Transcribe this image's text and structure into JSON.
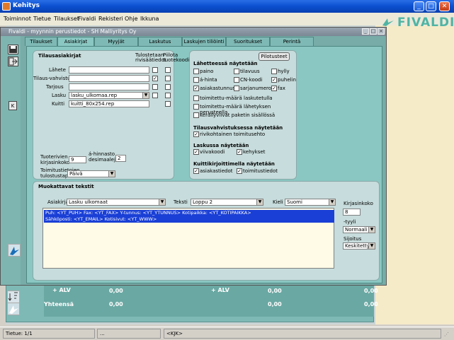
{
  "window": {
    "title": "Kehitys"
  },
  "menu": [
    "Toiminnot",
    "Tietue",
    "Tilaukset",
    "Fivaldi",
    "Rekisteri",
    "Ohje",
    "Ikkuna"
  ],
  "logo": {
    "text": "FIVALDI",
    "color": "#4fb4a4"
  },
  "child": {
    "title": "Fivaldi - myynnin perustiedot - SH Malliyritys Oy"
  },
  "tabs": [
    "Tilaukset",
    "Asiakirjat",
    "Myyjät",
    "Laskutus",
    "Laskujen tiliöinti",
    "Suoritukset",
    "Perintä"
  ],
  "active_tab": "Asiakirjat",
  "tilausasiakirjat": {
    "header": "Tilausasiakirjat",
    "col1": "Tulostetaan rivisäätiedot",
    "col2": "Piilota tuotekoodi",
    "rows": [
      {
        "label": "Lähete",
        "value": "",
        "c1": false,
        "c2": false
      },
      {
        "label": "Tilaus-vahvistus",
        "value": "",
        "c1": true,
        "c2": false
      },
      {
        "label": "Tarjous",
        "value": "",
        "c1": false,
        "c2": false
      },
      {
        "label": "Lasku",
        "value": "lasku_ulkomaa.rep",
        "c1": false,
        "c2": false
      },
      {
        "label": "Kuitti",
        "value": "kuitti_80x254.rep",
        "c1": false,
        "c2": false
      }
    ],
    "tuoterivien_label": "Tuoterivien kirjasinkoko",
    "tuoterivien_value": "9",
    "ahinnasto_label": "á-hinnasto desimaaleja",
    "ahinnasto_value": "2",
    "toimitus_label": "Toimitustietojen tulostustapa",
    "toimitus_value": "Päivä"
  },
  "pilotusteet_button": "Pilotusteet",
  "lahetteessa": {
    "header": "Lähetteessä näytetään",
    "items": [
      {
        "label": "paino",
        "checked": false
      },
      {
        "label": "tilavuus",
        "checked": false
      },
      {
        "label": "hylly",
        "checked": false
      },
      {
        "label": "á-hinta",
        "checked": false
      },
      {
        "label": "CN-koodi",
        "checked": false
      },
      {
        "label": "puhelin",
        "checked": true
      },
      {
        "label": "asiakastunnus",
        "checked": true
      },
      {
        "label": "sarjanumerot",
        "checked": false
      },
      {
        "label": "fax",
        "checked": true
      }
    ],
    "wide_items": [
      {
        "label": "toimitettu-määrä laskutetulla",
        "checked": false
      },
      {
        "label": "toimitettu-määrä lähetyksen perusteella",
        "checked": false
      },
      {
        "label": "keräilyviivat paketin sisällössä",
        "checked": false
      }
    ]
  },
  "tilausvahvistus": {
    "header": "Tilausvahvistuksessa näytetään",
    "items": [
      {
        "label": "rivikohtainen toimitusehto",
        "checked": true
      }
    ]
  },
  "laskussa": {
    "header": "Laskussa näytetään",
    "items": [
      {
        "label": "viivakoodi",
        "checked": true
      },
      {
        "label": "kehykset",
        "checked": true
      }
    ]
  },
  "kuitti": {
    "header": "Kuittikirjoittimella näytetään",
    "items": [
      {
        "label": "asiakastiedot",
        "checked": true
      },
      {
        "label": "toimitustiedot",
        "checked": true
      }
    ]
  },
  "muokattavat": {
    "header": "Muokattavat tekstit",
    "asiakirja_label": "Asiakirja",
    "asiakirja_value": "Lasku ulkomaat",
    "teksti_label": "Teksti",
    "teksti_value": "Loppu 2",
    "kieli_label": "Kieli",
    "kieli_value": "Suomi",
    "lines": [
      "Puh: <YT_PUH> Fax: <YT_FAX> Y-tunnus: <YT_YTUNNUS> Kotipaikka: <YT_KOTIPAIKKA>",
      "Sähköposti: <YT_EMAIL> Kotisivut: <YT_WWW>"
    ],
    "kirjasinkoko_label": "Kirjasinkoko",
    "kirjasinkoko_value": "8",
    "tyyli_label": "-tyyli",
    "tyyli_value": "Normaali",
    "sijoitus_label": "Sijoitus",
    "sijoitus_value": "Keskitetty"
  },
  "totals": {
    "alv_label": "+ ALV",
    "alv_value1": "0,00",
    "alv_label2": "+ ALV",
    "alv_value2": "0,00",
    "alv_value3": "0,00",
    "yht_label": "Yhteensä",
    "yht_value1": "0,00",
    "yht_value2": "0,00",
    "yht_value3": "0,00"
  },
  "status": {
    "record": "Tietue: 1/1",
    "mid": "...",
    "kjk": "<KJK>"
  }
}
